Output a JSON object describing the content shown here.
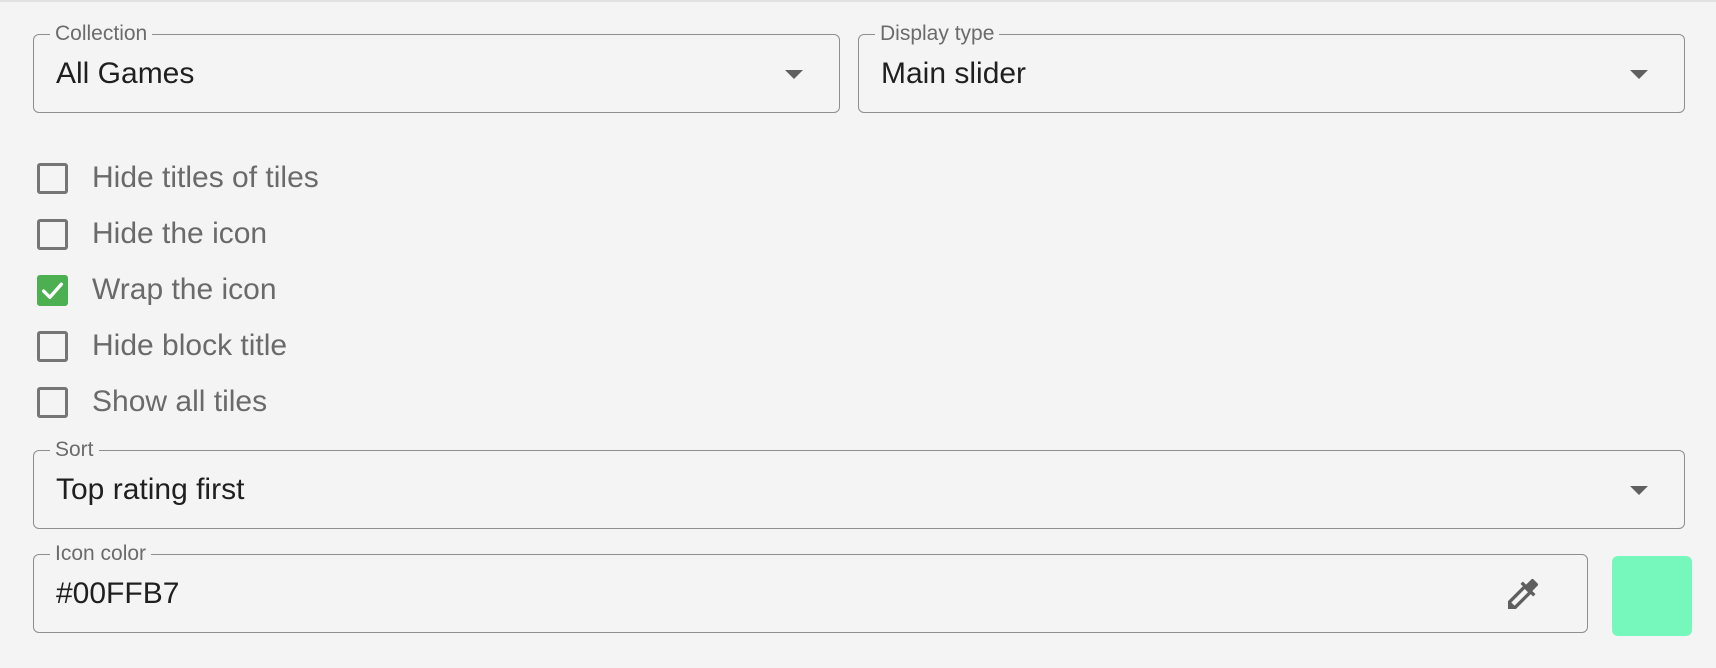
{
  "collection": {
    "legend": "Collection",
    "value": "All Games"
  },
  "display_type": {
    "legend": "Display type",
    "value": "Main slider"
  },
  "options": [
    {
      "label": "Hide titles of tiles",
      "checked": false
    },
    {
      "label": "Hide the icon",
      "checked": false
    },
    {
      "label": "Wrap the icon",
      "checked": true
    },
    {
      "label": "Hide block title",
      "checked": false
    },
    {
      "label": "Show all tiles",
      "checked": false
    }
  ],
  "sort": {
    "legend": "Sort",
    "value": "Top rating first"
  },
  "icon_color": {
    "legend": "Icon color",
    "value": "#00FFB7",
    "swatch_color": "#76F8BD",
    "picker_icon": "eyedropper-icon"
  },
  "colors": {
    "check_green": "#4CAF50",
    "border": "#8E8E8E",
    "background": "#F4F4F4"
  }
}
